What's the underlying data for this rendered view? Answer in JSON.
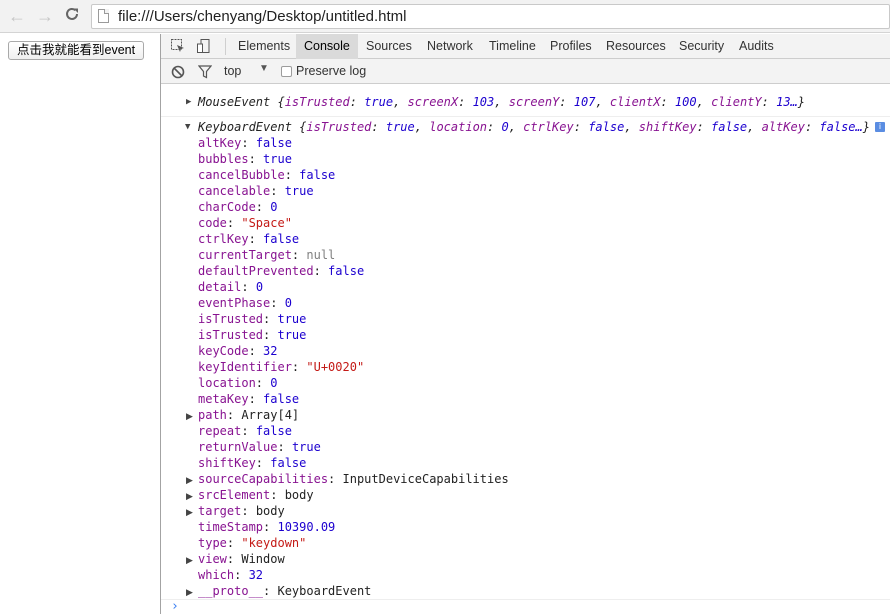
{
  "browser": {
    "url": "file:///Users/chenyang/Desktop/untitled.html",
    "back_icon": "←",
    "forward_icon": "→",
    "reload_icon": "C"
  },
  "page": {
    "button_label": "点击我就能看到event"
  },
  "devtools": {
    "tabs": [
      "Elements",
      "Console",
      "Sources",
      "Network",
      "Timeline",
      "Profiles",
      "Resources",
      "Security",
      "Audits"
    ],
    "active_tab": "Console",
    "filter": {
      "context": "top",
      "preserve_log_label": "Preserve log"
    }
  },
  "console": {
    "mouse_event": {
      "class": "MouseEvent",
      "summary": [
        {
          "k": "isTrusted",
          "v": "true"
        },
        {
          "k": "screenX",
          "v": "103"
        },
        {
          "k": "screenY",
          "v": "107"
        },
        {
          "k": "clientX",
          "v": "100"
        },
        {
          "k": "clientY",
          "v": "13…"
        }
      ]
    },
    "keyboard_event": {
      "class": "KeyboardEvent",
      "summary": [
        {
          "k": "isTrusted",
          "v": "true"
        },
        {
          "k": "location",
          "v": "0"
        },
        {
          "k": "ctrlKey",
          "v": "false"
        },
        {
          "k": "shiftKey",
          "v": "false"
        },
        {
          "k": "altKey",
          "v": "false…"
        }
      ],
      "properties": [
        {
          "name": "altKey",
          "value": "false",
          "type": "b"
        },
        {
          "name": "bubbles",
          "value": "true",
          "type": "b"
        },
        {
          "name": "cancelBubble",
          "value": "false",
          "type": "b"
        },
        {
          "name": "cancelable",
          "value": "true",
          "type": "b"
        },
        {
          "name": "charCode",
          "value": "0",
          "type": "b"
        },
        {
          "name": "code",
          "value": "\"Space\"",
          "type": "s"
        },
        {
          "name": "ctrlKey",
          "value": "false",
          "type": "b"
        },
        {
          "name": "currentTarget",
          "value": "null",
          "type": "n"
        },
        {
          "name": "defaultPrevented",
          "value": "false",
          "type": "b"
        },
        {
          "name": "detail",
          "value": "0",
          "type": "b"
        },
        {
          "name": "eventPhase",
          "value": "0",
          "type": "b"
        },
        {
          "name": "isTrusted",
          "value": "true",
          "type": "b"
        },
        {
          "name": "isTrusted",
          "value": "true",
          "type": "b"
        },
        {
          "name": "keyCode",
          "value": "32",
          "type": "b"
        },
        {
          "name": "keyIdentifier",
          "value": "\"U+0020\"",
          "type": "s"
        },
        {
          "name": "location",
          "value": "0",
          "type": "b"
        },
        {
          "name": "metaKey",
          "value": "false",
          "type": "b"
        },
        {
          "name": "path",
          "value": "Array[4]",
          "type": "o",
          "expandable": true
        },
        {
          "name": "repeat",
          "value": "false",
          "type": "b"
        },
        {
          "name": "returnValue",
          "value": "true",
          "type": "b"
        },
        {
          "name": "shiftKey",
          "value": "false",
          "type": "b"
        },
        {
          "name": "sourceCapabilities",
          "value": "InputDeviceCapabilities",
          "type": "o",
          "expandable": true
        },
        {
          "name": "srcElement",
          "value": "body",
          "type": "o",
          "expandable": true
        },
        {
          "name": "target",
          "value": "body",
          "type": "o",
          "expandable": true
        },
        {
          "name": "timeStamp",
          "value": "10390.09",
          "type": "b"
        },
        {
          "name": "type",
          "value": "\"keydown\"",
          "type": "s"
        },
        {
          "name": "view",
          "value": "Window",
          "type": "o",
          "expandable": true
        },
        {
          "name": "which",
          "value": "32",
          "type": "b"
        },
        {
          "name": "__proto__",
          "value": "KeyboardEvent",
          "type": "o",
          "expandable": true
        }
      ]
    },
    "prompt": "›"
  },
  "colors": {
    "property_name": "#881391",
    "number_bool": "#1c00cf",
    "string": "#c41a16",
    "null": "#808080",
    "active_tab_bg": "#dadada"
  }
}
